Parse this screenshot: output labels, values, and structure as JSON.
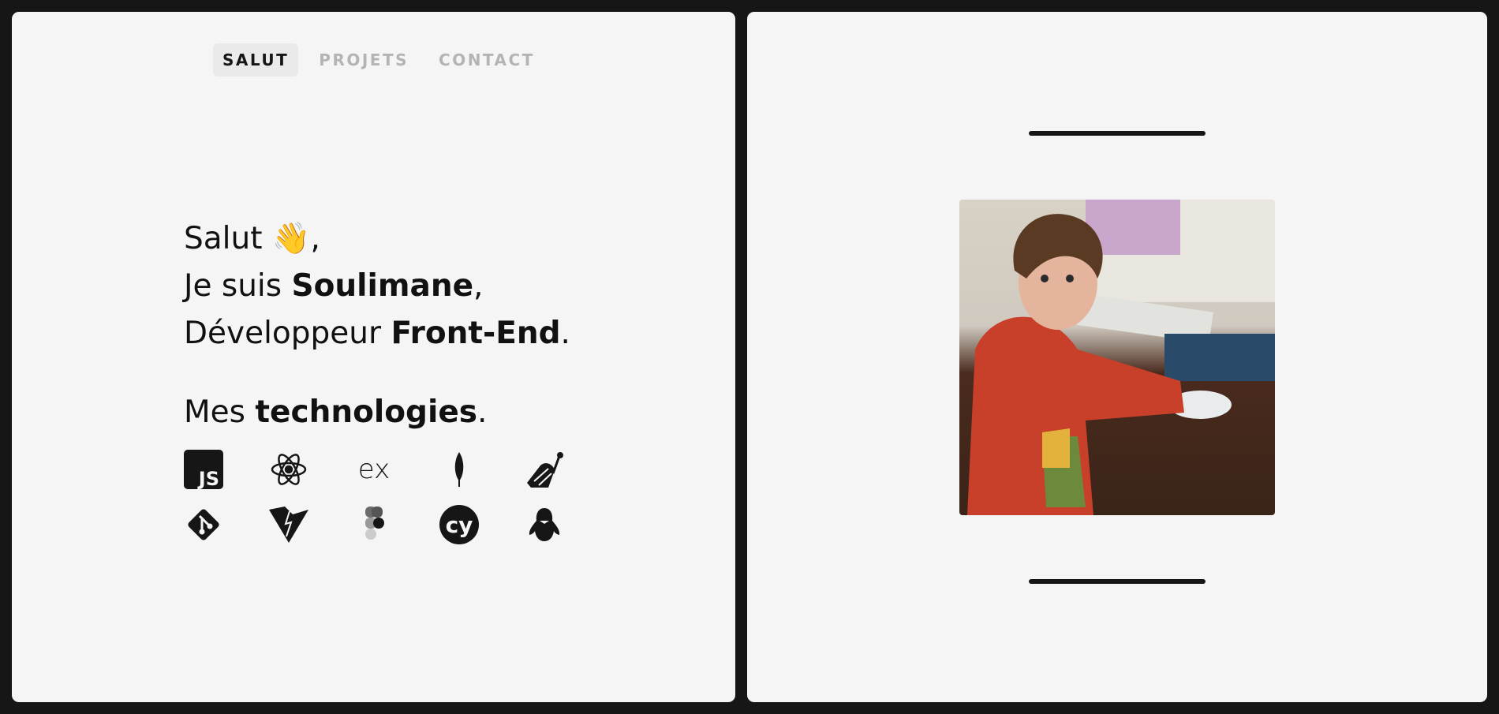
{
  "nav": {
    "items": [
      {
        "label": "SALUT",
        "active": true
      },
      {
        "label": "PROJETS",
        "active": false
      },
      {
        "label": "CONTACT",
        "active": false
      }
    ]
  },
  "intro": {
    "greeting": "Salut",
    "wave": "👋",
    "comma": ",",
    "line2_pre": "Je suis ",
    "name": "Soulimane",
    "line2_post": ",",
    "line3_pre": "Développeur ",
    "role": "Front-End",
    "line3_post": "."
  },
  "tech": {
    "pre": "Mes ",
    "bold": "technologies",
    "post": ".",
    "icons": [
      "javascript-icon",
      "react-icon",
      "express-icon",
      "mongodb-icon",
      "jest-icon",
      "git-icon",
      "vite-icon",
      "figma-icon",
      "cypress-icon",
      "linux-icon"
    ],
    "js_label": "JS",
    "express_label": "ex",
    "cypress_label": "cy"
  },
  "colors": {
    "background": "#161616",
    "panel": "#f5f5f5",
    "muted": "#b4b4b4"
  }
}
